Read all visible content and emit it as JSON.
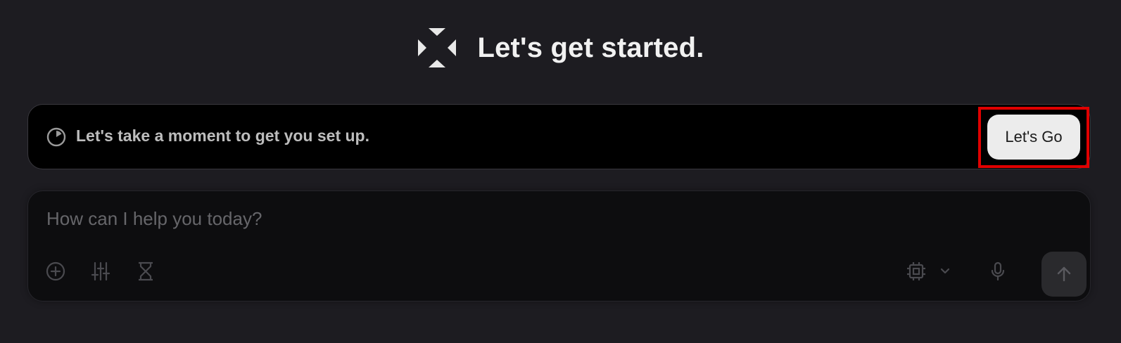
{
  "header": {
    "title": "Let's get started.",
    "logo_icon": "diamond-cross-logo-icon"
  },
  "setup_banner": {
    "icon": "progress-circle-icon",
    "message": "Let's take a moment to get you set up.",
    "button_label": "Let's Go"
  },
  "composer": {
    "placeholder": "How can I help you today?",
    "value": "",
    "left_tools": [
      "plus-circle-icon",
      "sliders-icon",
      "hourglass-icon"
    ],
    "right_tools": [
      "cpu-model-icon",
      "chevron-down-icon",
      "microphone-icon"
    ],
    "send_icon": "arrow-up-icon"
  },
  "colors": {
    "page_background": "#1d1c21",
    "banner_background": "#000000",
    "composer_background": "#0d0d0f",
    "button_background": "#ececec",
    "highlight": "#e00000",
    "icon_muted": "#4a4a4f"
  }
}
